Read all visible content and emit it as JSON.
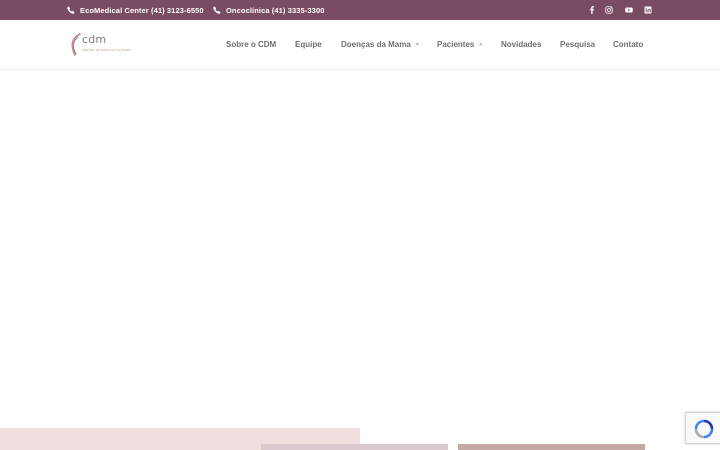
{
  "topbar": {
    "background": "#7a4c63",
    "phones": [
      {
        "icon": "phone-icon",
        "label": "EcoMedical Center (41) 3123-6550"
      },
      {
        "icon": "phone-icon",
        "label": "Oncoclínica (41) 3335-3300"
      }
    ],
    "social": [
      "facebook-icon",
      "instagram-icon",
      "youtube-icon",
      "linkedin-icon"
    ]
  },
  "logo": {
    "word": "cdm",
    "tagline": "CENTRO DE DOENÇAS DA MAMA"
  },
  "nav": {
    "items": [
      {
        "label": "Sobre o CDM",
        "has_dropdown": false
      },
      {
        "label": "Equipe",
        "has_dropdown": false
      },
      {
        "label": "Doenças da Mama",
        "has_dropdown": true
      },
      {
        "label": "Pacientes",
        "has_dropdown": true
      },
      {
        "label": "Novidades",
        "has_dropdown": false
      },
      {
        "label": "Pesquisa",
        "has_dropdown": false
      },
      {
        "label": "Contato",
        "has_dropdown": false
      }
    ],
    "caret": "▼"
  },
  "colors": {
    "brand_purple": "#7a4c63",
    "pink_block": "#f1dfdf",
    "nav_text": "#6e6e6e"
  }
}
